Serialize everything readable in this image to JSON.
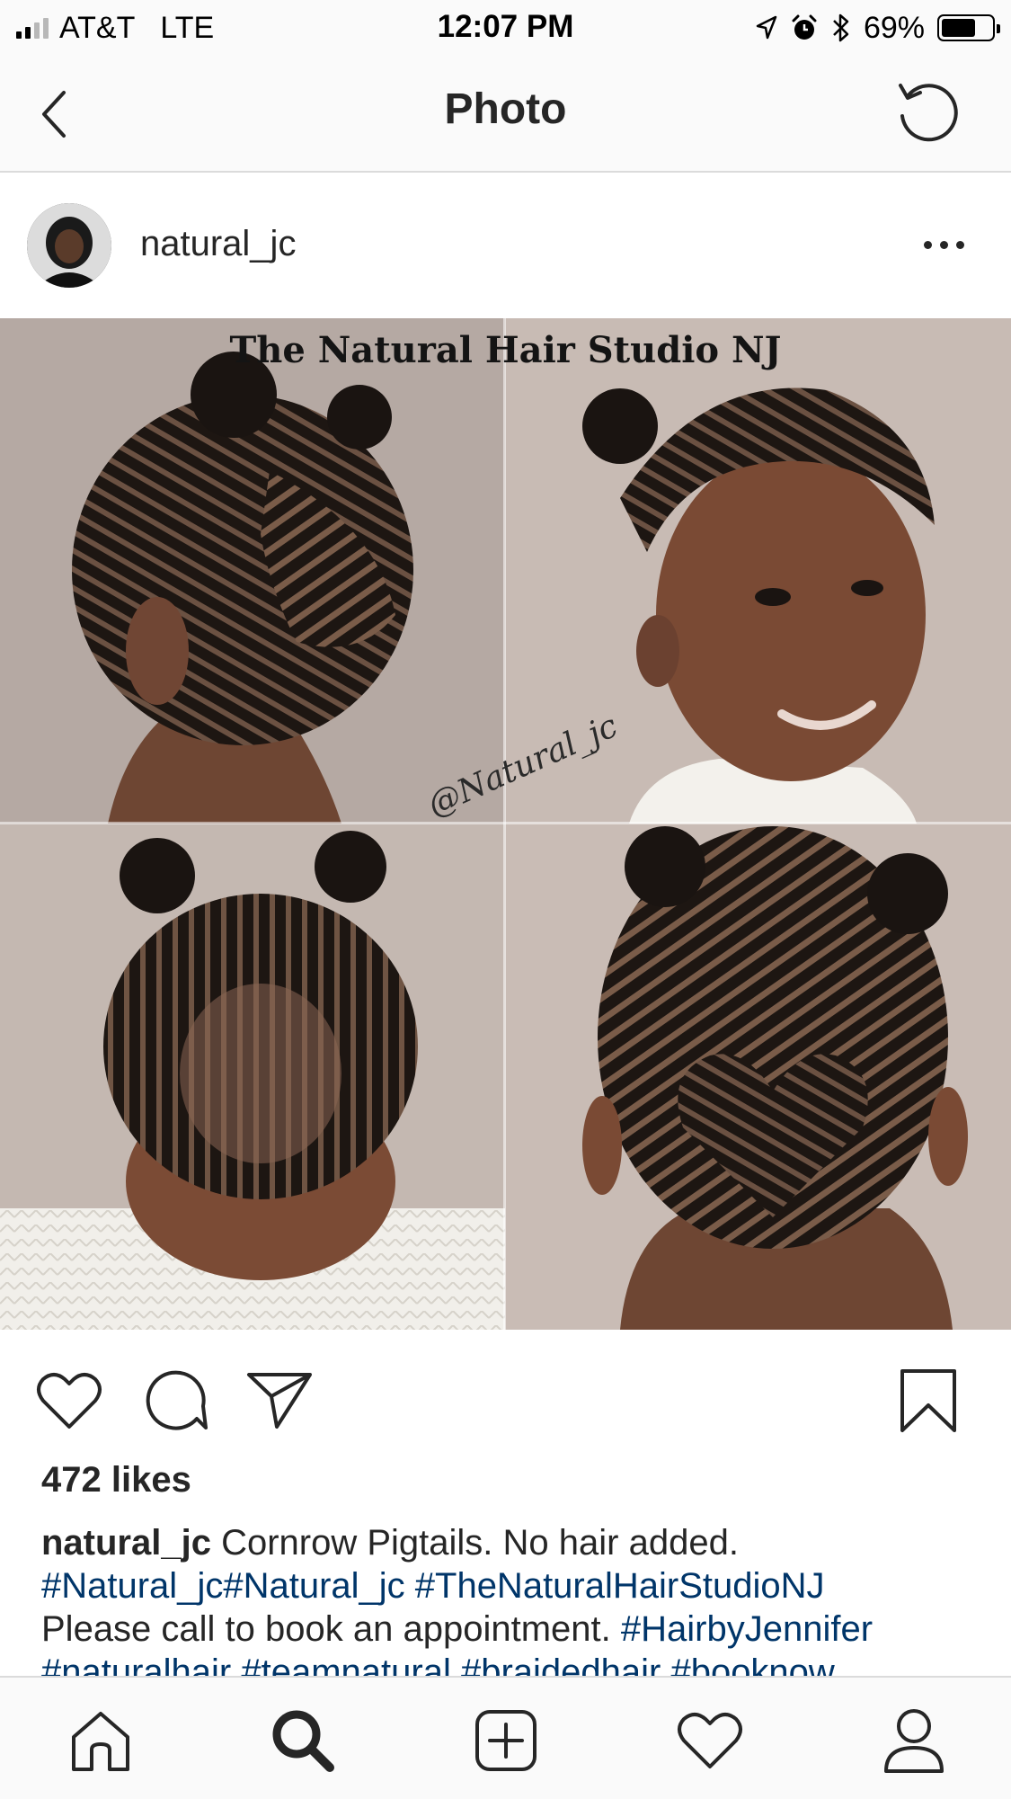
{
  "status_bar": {
    "carrier": "AT&T",
    "network": "LTE",
    "time": "12:07 PM",
    "battery_percent": "69%",
    "battery_level": 0.69,
    "signal_bars_filled": 2,
    "signal_bars_total": 4,
    "icons": [
      "location-arrow-icon",
      "alarm-icon",
      "bluetooth-icon",
      "battery-icon"
    ]
  },
  "nav": {
    "title": "Photo",
    "back_icon": "chevron-left-icon",
    "refresh_icon": "refresh-icon"
  },
  "post": {
    "username": "natural_jc",
    "more_icon": "more-dots-icon",
    "photo": {
      "overlay_title": "The Natural Hair Studio NJ",
      "watermark": "@Natural_jc"
    },
    "actions": [
      "heart-icon",
      "comment-icon",
      "share-icon",
      "bookmark-icon"
    ],
    "likes": "472 likes",
    "caption": {
      "user": "natural_jc",
      "text": "Cornrow Pigtails. No hair added.",
      "line2": "#Natural_jc#Natural_jc #TheNaturalHairStudioNJ",
      "line3_text": "Please call to book an appointment.",
      "line3_tag": "#HairbyJennifer",
      "line4": "#naturalhair #teamnatural #braidedhair #booknow"
    }
  },
  "tab_bar": {
    "tabs": [
      "home-icon",
      "search-icon",
      "add-post-icon",
      "activity-heart-icon",
      "profile-icon"
    ],
    "active": "search-icon"
  },
  "colors": {
    "hashtag": "#003569",
    "text": "#262626",
    "bar_background": "#fafafa",
    "divider": "#dbdbdb"
  }
}
